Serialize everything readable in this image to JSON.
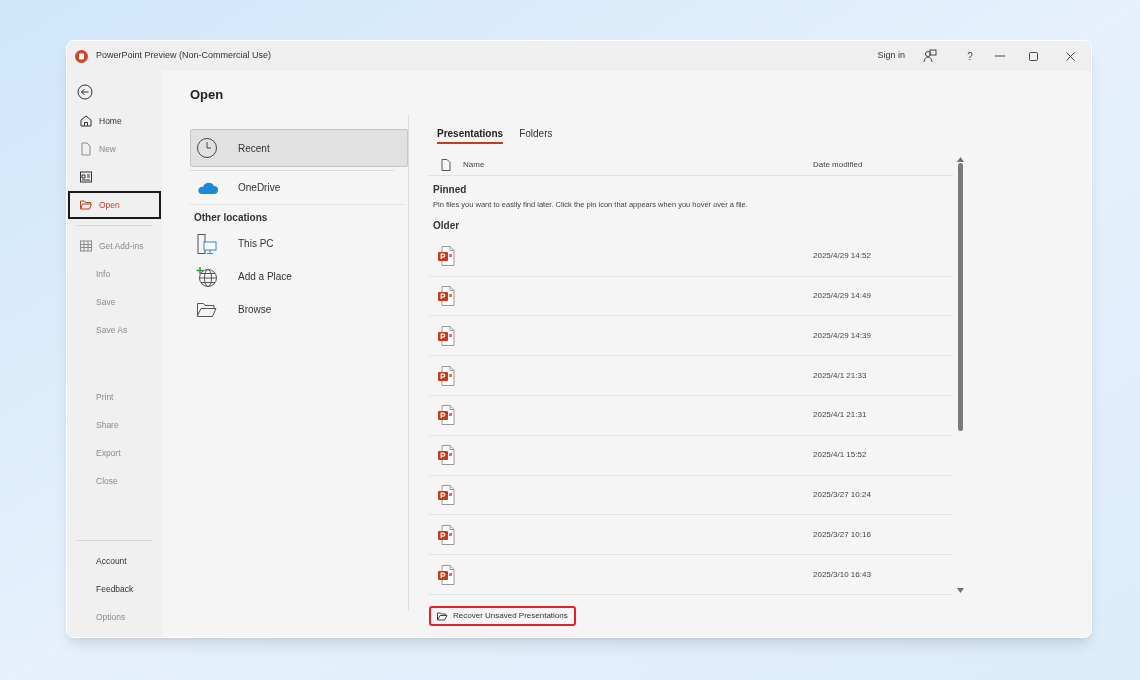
{
  "window": {
    "title": "PowerPoint Preview (Non-Commercial Use)",
    "sign_in": "Sign in",
    "help": "?"
  },
  "sidebar": {
    "items": [
      {
        "kind": "icon",
        "label": "Home",
        "disabled": false,
        "selected": false
      },
      {
        "kind": "icon",
        "label": "New",
        "disabled": true,
        "selected": false
      },
      {
        "kind": "icon_only",
        "disabled": false,
        "selected": false
      },
      {
        "kind": "icon",
        "label": "Open",
        "disabled": false,
        "selected": true
      },
      {
        "kind": "divider"
      },
      {
        "kind": "icon",
        "label": "Get Add-ins",
        "disabled": true,
        "selected": false
      },
      {
        "kind": "text",
        "label": "Info",
        "disabled": true,
        "selected": false
      },
      {
        "kind": "text",
        "label": "Save",
        "disabled": true,
        "selected": false
      },
      {
        "kind": "text",
        "label": "Save As",
        "disabled": true,
        "selected": false
      },
      {
        "kind": "spacer"
      },
      {
        "kind": "text",
        "label": "Print",
        "disabled": true,
        "selected": false
      },
      {
        "kind": "text",
        "label": "Share",
        "disabled": true,
        "selected": false
      },
      {
        "kind": "text",
        "label": "Export",
        "disabled": true,
        "selected": false
      },
      {
        "kind": "text",
        "label": "Close",
        "disabled": true,
        "selected": false
      },
      {
        "kind": "spacer"
      },
      {
        "kind": "divider"
      },
      {
        "kind": "text",
        "label": "Account",
        "disabled": false,
        "selected": false
      },
      {
        "kind": "text",
        "label": "Feedback",
        "disabled": false,
        "selected": false
      },
      {
        "kind": "text",
        "label": "Options",
        "disabled": true,
        "selected": false
      }
    ]
  },
  "heading": "Open",
  "locations": [
    {
      "kind": "item",
      "label": "Recent",
      "selected": true
    },
    {
      "kind": "item",
      "label": "OneDrive",
      "selected": false
    },
    {
      "kind": "header",
      "label": "Other locations"
    },
    {
      "kind": "item",
      "label": "This PC",
      "selected": false
    },
    {
      "kind": "item",
      "label": "Add a Place",
      "selected": false
    },
    {
      "kind": "item",
      "label": "Browse",
      "selected": false
    }
  ],
  "tabs": [
    {
      "label": "Presentations",
      "selected": true
    },
    {
      "label": "Folders",
      "selected": false
    }
  ],
  "table": {
    "columns": [
      "Name",
      "Date modified"
    ],
    "pinned_title": "Pinned",
    "pinned_hint": "Pin files you want to easily find later. Click the pin icon that appears when you hover over a file.",
    "group_title": "Older",
    "rows": [
      {
        "date": "2025/4/29 14:52"
      },
      {
        "date": "2025/4/29 14:49"
      },
      {
        "date": "2025/4/29 14:39"
      },
      {
        "date": "2025/4/1 21:33"
      },
      {
        "date": "2025/4/1 21:31"
      },
      {
        "date": "2025/4/1 15:52"
      },
      {
        "date": "2025/3/27 10:24"
      },
      {
        "date": "2025/3/27 10:16"
      },
      {
        "date": "2025/3/10 16:43"
      }
    ]
  },
  "recover_button": "Recover Unsaved Presentations"
}
